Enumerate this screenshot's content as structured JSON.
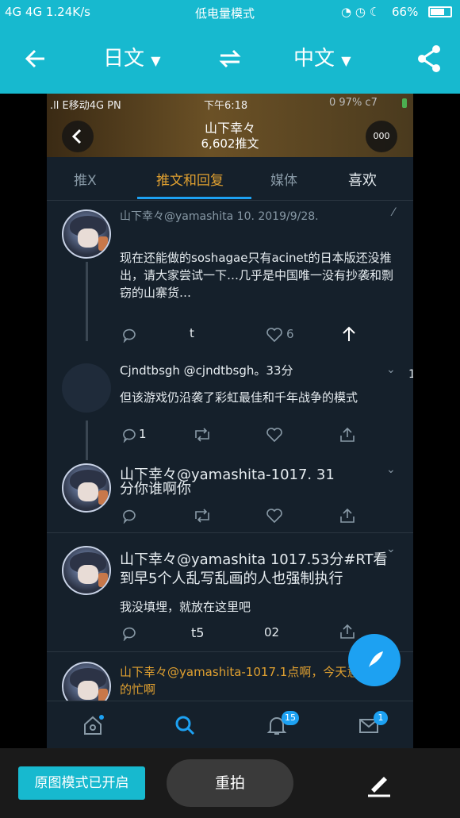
{
  "statusbar": {
    "left": "4G 4G 1.24K/s",
    "center": "低电量模式",
    "battery": "66%"
  },
  "topbar": {
    "source_lang": "日文",
    "target_lang": "中文"
  },
  "phone": {
    "statusbar_left": ".ll E移动4G PN",
    "statusbar_time": "下午6:18",
    "statusbar_right": "0 97% c7",
    "profile_name": "山下幸々",
    "tweet_count": "6,602推文",
    "more_label": "000",
    "tabs": [
      "推X",
      "推文和回复",
      "媒体",
      "喜欢"
    ],
    "tweets": [
      {
        "name": "山下幸々@yamashita 10. 2019/9/28.",
        "text": "现在还能做的soshagae只有acinet的日本版还没推出，请大家尝试一下…几乎是中国唯一没有抄袭和剽窃的山寨货…",
        "reply": "",
        "retweet": "t",
        "like": "6",
        "share": ""
      },
      {
        "name": "Cjndtbsgh @cjndtbsgh。33分",
        "text": "但该游戏仍沿袭了彩虹最佳和千年战争的模式",
        "reply": "1",
        "retweet": "",
        "like": "",
        "side_mark": "1"
      },
      {
        "name": "山下幸々@yamashita-1017. 31",
        "text": "分你谁啊你"
      },
      {
        "name": "山下幸々@yamashita 1017.53分#RT看到早5个人乱写乱画的人也强制执行",
        "text": "我没填埋，就放在这里吧",
        "retweet": "t5",
        "like": "02"
      },
      {
        "name": "山下幸々@yamashita-1017.1点啊，今天意外的忙啊"
      }
    ],
    "nav_badges": {
      "notifications": "15",
      "messages": "1"
    }
  },
  "bottombar": {
    "mode_label": "原图模式已开启",
    "retake_label": "重拍"
  },
  "colors": {
    "accent": "#17b9cf",
    "twitter_blue": "#1da1f2",
    "highlight": "#e0a030"
  }
}
